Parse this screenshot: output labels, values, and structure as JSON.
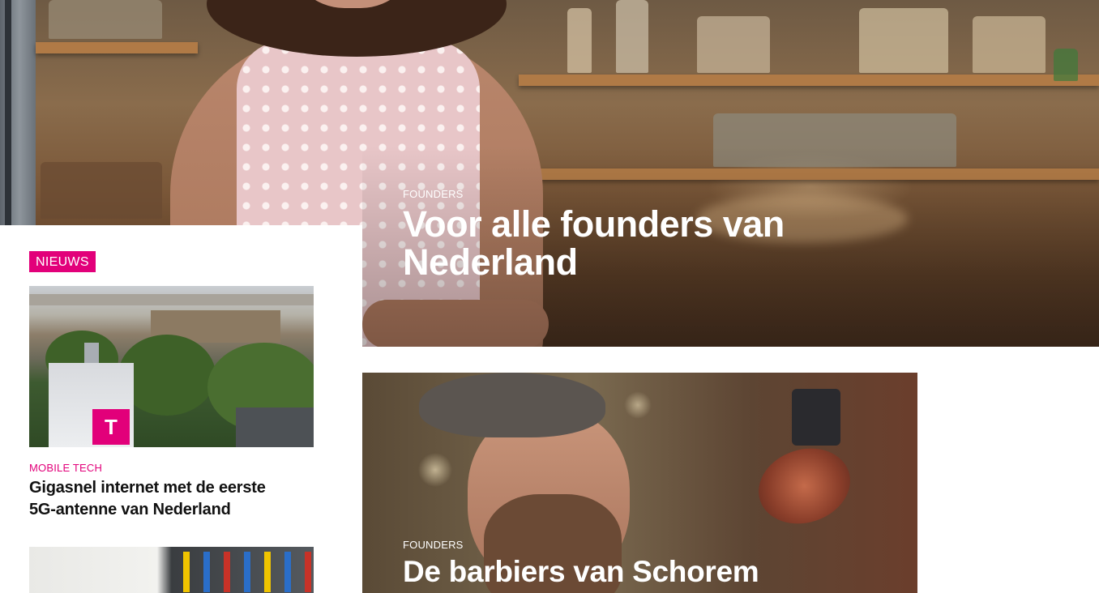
{
  "hero": {
    "category": "FOUNDERS",
    "title_line1": "Voor alle founders van",
    "title_line2": "Nederland"
  },
  "news_column": {
    "badge": "NIEUWS",
    "article": {
      "category": "MOBILE TECH",
      "title_line1": "Gigasnel internet met de eerste",
      "title_line2": "5G-antenne van Nederland",
      "image_logo": "T"
    }
  },
  "barber_card": {
    "category": "FOUNDERS",
    "title": "De barbiers van Schorem"
  },
  "colors": {
    "accent": "#e2007a",
    "text_dark": "#111111",
    "text_light": "#ffffff"
  }
}
